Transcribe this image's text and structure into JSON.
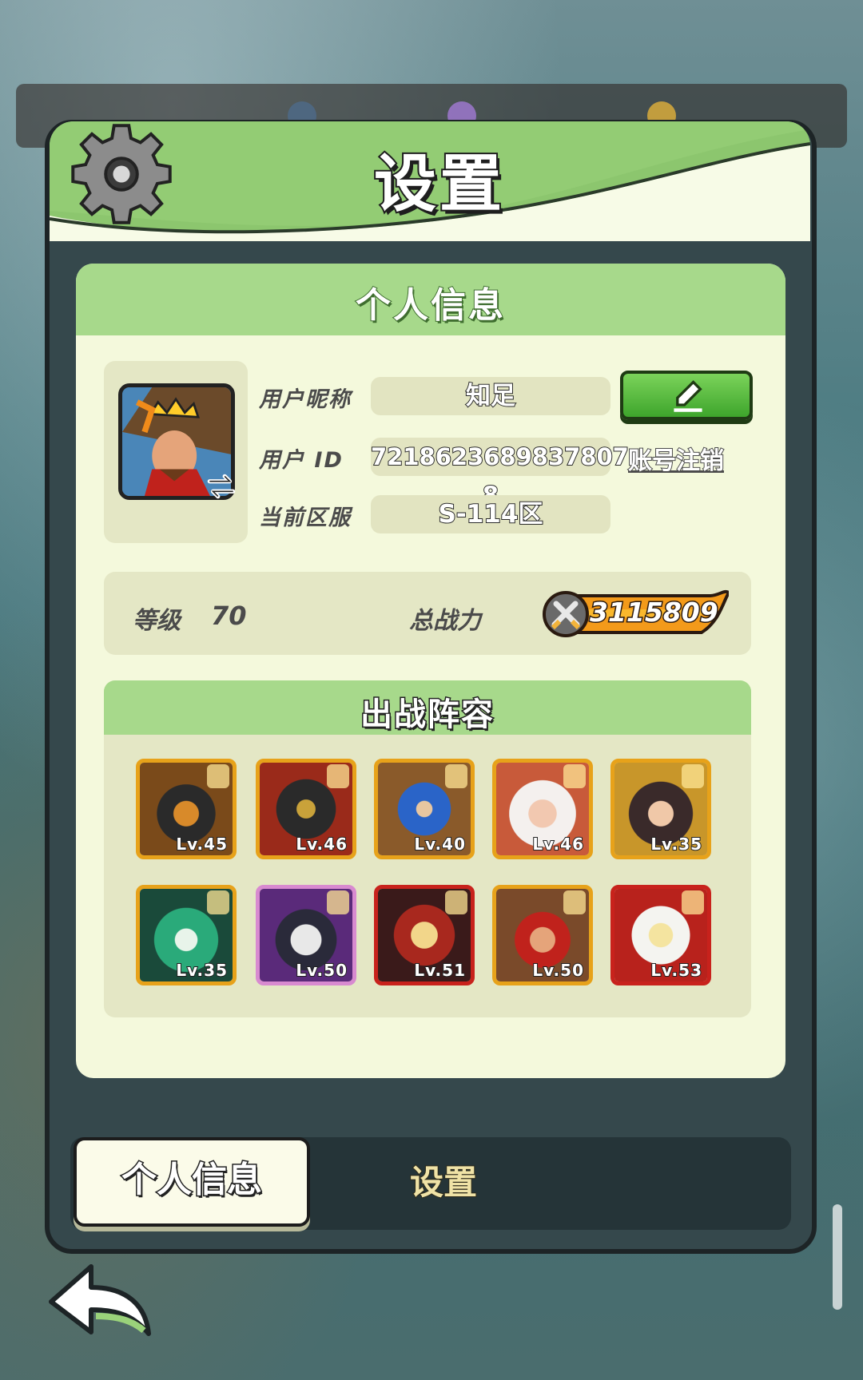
{
  "dialog": {
    "title": "设置"
  },
  "profile": {
    "section_title": "个人信息",
    "nickname_label": "用户昵称",
    "nickname_value": "知足",
    "id_label": "用户 ID",
    "id_value": "7218623689837807​8",
    "server_label": "当前区服",
    "server_value": "S-114区",
    "deregister_label": "账号注销"
  },
  "stats": {
    "level_label": "等级",
    "level_value": "70",
    "power_label": "总战力",
    "power_value": "3115809"
  },
  "lineup": {
    "title": "出战阵容",
    "heroes": [
      {
        "level": "Lv.45"
      },
      {
        "level": "Lv.46"
      },
      {
        "level": "Lv.40"
      },
      {
        "level": "Lv.46"
      },
      {
        "level": "Lv.35"
      },
      {
        "level": "Lv.35"
      },
      {
        "level": "Lv.50"
      },
      {
        "level": "Lv.51"
      },
      {
        "level": "Lv.50"
      },
      {
        "level": "Lv.53"
      }
    ]
  },
  "tabs": {
    "active_label": "个人信息",
    "inactive_label": "设置"
  },
  "colors": {
    "header_green": "#a7d98b",
    "card_bg": "#f4f9dc",
    "panel_bg": "#e4e7c5",
    "edit_green": "#4bb736"
  }
}
